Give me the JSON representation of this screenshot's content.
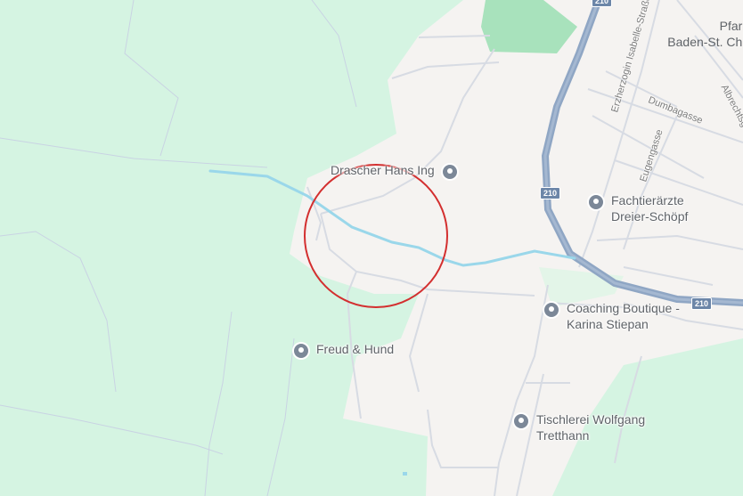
{
  "map": {
    "colors": {
      "forest": "#d5f4e2",
      "park": "#a8e2bc",
      "land": "#f5f3f1",
      "highway": "#8fa6c4",
      "stream": "#9ad7ea",
      "selection_circle": "#d32f2f",
      "label": "#5f6368"
    },
    "pois": [
      {
        "name": "Drascher Hans Ing",
        "icon": "map-pin-icon"
      },
      {
        "name": "Fachtierärzte Dreier-Schöpf",
        "icon": "map-pin-icon"
      },
      {
        "name": "Coaching Boutique - Karina Stiepan",
        "icon": "map-pin-icon"
      },
      {
        "name": "Freud & Hund",
        "icon": "map-pin-icon"
      },
      {
        "name": "Tischlerei Wolfgang Tretthann",
        "icon": "map-pin-icon"
      }
    ],
    "streets": [
      {
        "name": "Erzherzogin Isabelle-Straße"
      },
      {
        "name": "Dumbagasse"
      },
      {
        "name": "Eugengasse"
      },
      {
        "name": "Albrechtsgasse"
      }
    ],
    "area_labels": [
      "Pfarr",
      "Baden-St. Chr"
    ],
    "road_shields": [
      "210",
      "210",
      "210"
    ]
  }
}
